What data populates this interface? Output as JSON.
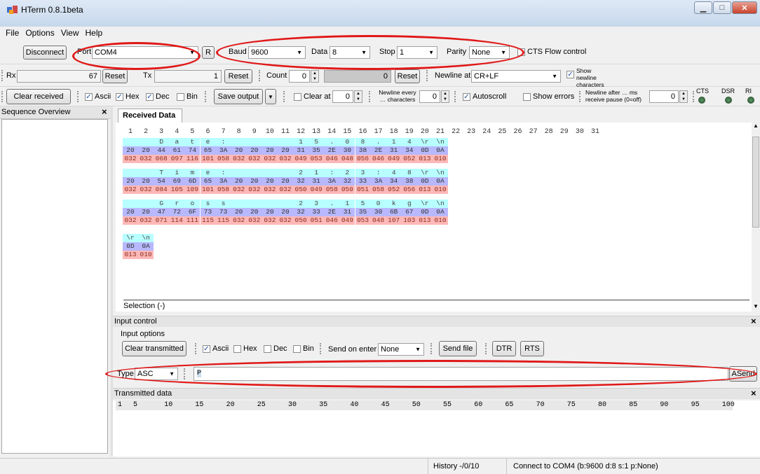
{
  "window": {
    "title": "HTerm 0.8.1beta"
  },
  "menu": [
    "File",
    "Options",
    "View",
    "Help"
  ],
  "connection": {
    "disconnect_label": "Disconnect",
    "port_label": "Port",
    "port_value": "COM4",
    "r_label": "R",
    "baud_label": "Baud",
    "baud_value": "9600",
    "data_label": "Data",
    "data_value": "8",
    "stop_label": "Stop",
    "stop_value": "1",
    "parity_label": "Parity",
    "parity_value": "None",
    "cts_label": "CTS Flow control"
  },
  "counters": {
    "rx_label": "Rx",
    "rx_value": "67",
    "reset_label": "Reset",
    "tx_label": "Tx",
    "tx_value": "1",
    "count_label": "Count",
    "count_value": "0",
    "count_display": "0",
    "newline_at_label": "Newline at",
    "newline_at_value": "CR+LF",
    "show_newline_label": "Show newline characters"
  },
  "display_opts": {
    "clear_received": "Clear received",
    "ascii": "Ascii",
    "hex": "Hex",
    "dec": "Dec",
    "bin": "Bin",
    "save_output": "Save output",
    "clear_at": "Clear at",
    "clear_at_value": "0",
    "newline_every": "Newline every … characters",
    "newline_every_value": "0",
    "autoscroll": "Autoscroll",
    "show_errors": "Show errors",
    "newline_after": "Newline after … ms receive pause (0=off)",
    "newline_after_value": "0",
    "cts": "CTS",
    "dsr": "DSR",
    "ri": "RI"
  },
  "sequence_overview": {
    "title": "Sequence Overview",
    "close": "×"
  },
  "received": {
    "tab_label": "Received Data",
    "selection": "Selection (-)",
    "column_numbers": [
      "1",
      "2",
      "3",
      "4",
      "5",
      "6",
      "7",
      "8",
      "9",
      "10",
      "11",
      "12",
      "13",
      "14",
      "15",
      "16",
      "17",
      "18",
      "19",
      "20",
      "21",
      "22",
      "23",
      "24",
      "25",
      "26",
      "27",
      "28",
      "29",
      "30",
      "31"
    ],
    "rows": [
      {
        "ascii": [
          "",
          "",
          "D",
          "a",
          "t",
          "e",
          ":",
          "",
          "",
          "",
          "",
          "1",
          "5",
          ".",
          "0",
          "8",
          ".",
          "1",
          "4",
          "\\r",
          "\\n"
        ],
        "hex": [
          "20",
          "20",
          "44",
          "61",
          "74",
          "65",
          "3A",
          "20",
          "20",
          "20",
          "20",
          "31",
          "35",
          "2E",
          "30",
          "38",
          "2E",
          "31",
          "34",
          "0D",
          "0A"
        ],
        "dec": [
          "032",
          "032",
          "068",
          "097",
          "116",
          "101",
          "058",
          "032",
          "032",
          "032",
          "032",
          "049",
          "053",
          "046",
          "048",
          "056",
          "046",
          "049",
          "052",
          "013",
          "010"
        ]
      },
      {
        "ascii": [
          "",
          "",
          "T",
          "i",
          "m",
          "e",
          ":",
          "",
          "",
          "",
          "",
          "2",
          "1",
          ":",
          "2",
          "3",
          ":",
          "4",
          "8",
          "\\r",
          "\\n"
        ],
        "hex": [
          "20",
          "20",
          "54",
          "69",
          "6D",
          "65",
          "3A",
          "20",
          "20",
          "20",
          "20",
          "32",
          "31",
          "3A",
          "32",
          "33",
          "3A",
          "34",
          "38",
          "0D",
          "0A"
        ],
        "dec": [
          "032",
          "032",
          "084",
          "105",
          "109",
          "101",
          "058",
          "032",
          "032",
          "032",
          "032",
          "050",
          "049",
          "058",
          "050",
          "051",
          "058",
          "052",
          "056",
          "013",
          "010"
        ]
      },
      {
        "ascii": [
          "",
          "",
          "G",
          "r",
          "o",
          "s",
          "s",
          "",
          "",
          "",
          "",
          "2",
          "3",
          ".",
          "1",
          "5",
          "0",
          "k",
          "g",
          "\\r",
          "\\n"
        ],
        "hex": [
          "20",
          "20",
          "47",
          "72",
          "6F",
          "73",
          "73",
          "20",
          "20",
          "20",
          "20",
          "32",
          "33",
          "2E",
          "31",
          "35",
          "30",
          "6B",
          "67",
          "0D",
          "0A"
        ],
        "dec": [
          "032",
          "032",
          "071",
          "114",
          "111",
          "115",
          "115",
          "032",
          "032",
          "032",
          "032",
          "050",
          "051",
          "046",
          "049",
          "053",
          "048",
          "107",
          "103",
          "013",
          "010"
        ]
      },
      {
        "ascii": [
          "\\r",
          "\\n"
        ],
        "hex": [
          "0D",
          "0A"
        ],
        "dec": [
          "013",
          "010"
        ]
      }
    ]
  },
  "input_control": {
    "section_title": "Input control",
    "options_title": "Input options",
    "clear_transmitted": "Clear transmitted",
    "ascii": "Ascii",
    "hex": "Hex",
    "dec": "Dec",
    "bin": "Bin",
    "send_on_enter_label": "Send on enter",
    "send_on_enter_value": "None",
    "send_file": "Send file",
    "dtr": "DTR",
    "rts": "RTS",
    "type_label": "Type",
    "type_value": "ASC",
    "input_value": "P",
    "asend": "ASend"
  },
  "transmitted": {
    "title": "Transmitted data",
    "ruler": [
      "1",
      "5",
      "10",
      "15",
      "20",
      "25",
      "30",
      "35",
      "40",
      "45",
      "50",
      "55",
      "60",
      "65",
      "70",
      "75",
      "80",
      "85",
      "90",
      "95",
      "100"
    ]
  },
  "status": {
    "history": "History -/0/10",
    "connection": "Connect to COM4 (b:9600 d:8 s:1 p:None)"
  },
  "colors": {
    "ascii_bg": "#b8ffff",
    "hex_bg": "#b8b8ff",
    "dec_bg": "#ffb8b8",
    "highlight": "#e01818"
  }
}
